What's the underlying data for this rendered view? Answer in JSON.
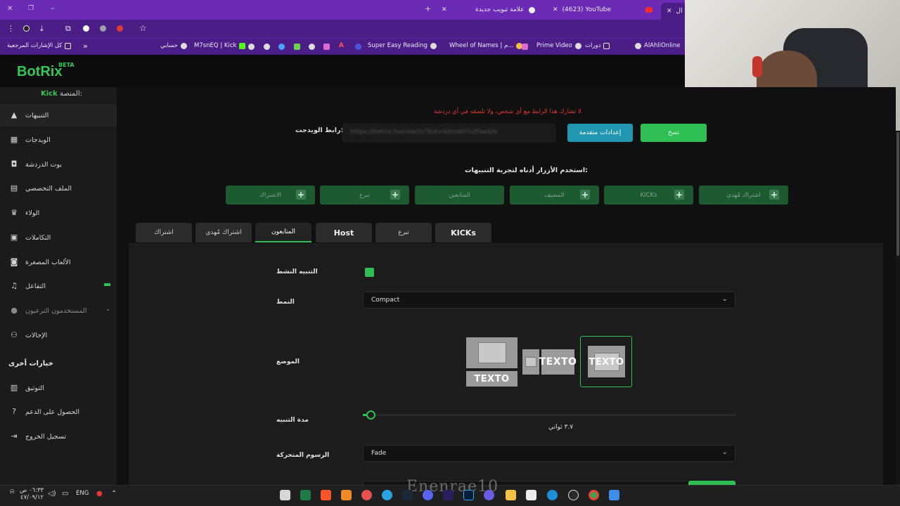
{
  "browser": {
    "tabs": [
      {
        "label": "(4623) YouTube"
      },
      {
        "label": "علامة تبويب جديدة"
      },
      {
        "label": "ال"
      }
    ],
    "bookmarks": [
      "AlAhliOnline",
      "دورات",
      "Prime Video",
      "Wheel of Names | م...",
      "Super Easy Reading",
      "M7snEQ | Kick",
      "حسابي",
      "كل الإشارات المرجعية"
    ]
  },
  "app": {
    "logo": "BotRix",
    "beta": "BETA",
    "platform_label": "المنصة:",
    "platform_value": "Kick"
  },
  "sidebar": {
    "items": [
      {
        "label": "التنبيهات",
        "icon": "alert-triangle-icon"
      },
      {
        "label": "الويدجات",
        "icon": "widgets-grid-icon"
      },
      {
        "label": "بوت الدردشة",
        "icon": "robot-icon"
      },
      {
        "label": "الملف التخصصي",
        "icon": "profile-card-icon"
      },
      {
        "label": "الولاء",
        "icon": "trophy-icon"
      },
      {
        "label": "التكاملات",
        "icon": "integration-icon"
      },
      {
        "label": "الألعاب المصغرة",
        "icon": "gamepad-icon"
      },
      {
        "label": "التفاعل",
        "icon": "music-note-icon"
      },
      {
        "label": "المستخدمون الترعيون",
        "icon": "users-icon"
      },
      {
        "label": "الإحالات",
        "icon": "referrals-icon"
      }
    ],
    "other_header": "خيارات أخرى",
    "other_items": [
      {
        "label": "التوثيق",
        "icon": "docs-icon"
      },
      {
        "label": "الحصول على الدعم",
        "icon": "help-icon"
      },
      {
        "label": "تسجيل الخروج",
        "icon": "logout-icon"
      }
    ]
  },
  "widget": {
    "warning": "لا تشارك هذا الرابط مع أي شخص، ولا تلصقه في أي دردشة",
    "url_label": "رابط الويدجت:",
    "url_value": "https://botrix.live/alerts?bid=&tmobi%2Fae&fs",
    "advanced_button": "إعدادات متقدمة",
    "copy_button": "نسخ"
  },
  "test": {
    "label": "استخدم الأزرار أدناه لتجربة التنبيهات:",
    "buttons": [
      "الاشتراك",
      "تبرع",
      "المتابعين",
      "المضيف",
      "KICKs",
      "اشتراك مُهدى"
    ]
  },
  "alert_tabs": [
    "اشتراك",
    "اشتراك مُهدى",
    "المتابعون",
    "Host",
    "تبرع",
    "KICKs"
  ],
  "form": {
    "active_label": "التنبيه النشط",
    "style_label": "النمط",
    "style_value": "Compact",
    "position_label": "الموضع",
    "position_text": "TEXTO",
    "duration_label": "مدة التنبيه",
    "duration_value": "٣.٧ ثواني",
    "duration_fraction": 0.02,
    "animation_label": "الرسوم المتحركة",
    "animation_value": "Fade"
  },
  "watermark": "Enenrae10",
  "taskbar": {
    "time": "٠٦:٣٣ ص",
    "date": "٤٧/٠٩/١٢",
    "lang": "ENG"
  },
  "colors": {
    "accent": "#2fbf55",
    "browser": "#6b2bb5",
    "warning": "#e53935",
    "info_button": "#2196b0"
  }
}
